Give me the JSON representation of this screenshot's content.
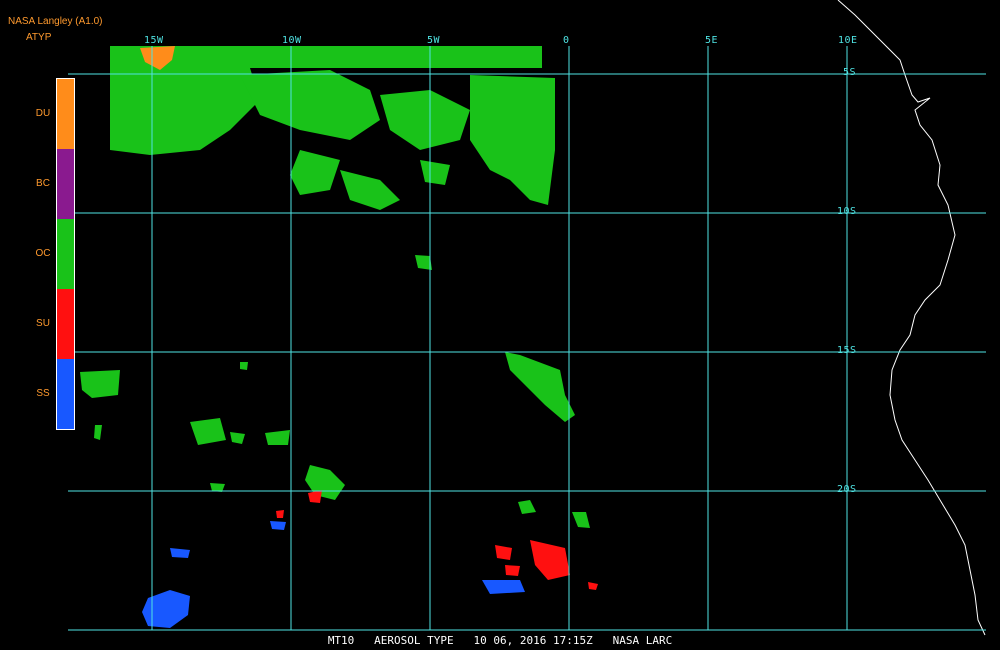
{
  "header": {
    "title": "NASA Langley (A1.0)",
    "product": "ATYP"
  },
  "legend": [
    {
      "code": "DU",
      "color": "#ff8c1a"
    },
    {
      "code": "BC",
      "color": "#8a1a8f"
    },
    {
      "code": "OC",
      "color": "#19c219"
    },
    {
      "code": "SU",
      "color": "#ff1010"
    },
    {
      "code": "SS",
      "color": "#1858ff"
    }
  ],
  "lon_labels": [
    "15W",
    "10W",
    "5W",
    "0",
    "5E",
    "10E"
  ],
  "lat_labels": [
    "5S",
    "10S",
    "15S",
    "20S"
  ],
  "footer": "MT10   AEROSOL TYPE   10 06, 2016 17:15Z   NASA LARC",
  "colors": {
    "grid": "#4fe3e3",
    "coast": "#ffffff",
    "header": "#ff9a2e"
  }
}
